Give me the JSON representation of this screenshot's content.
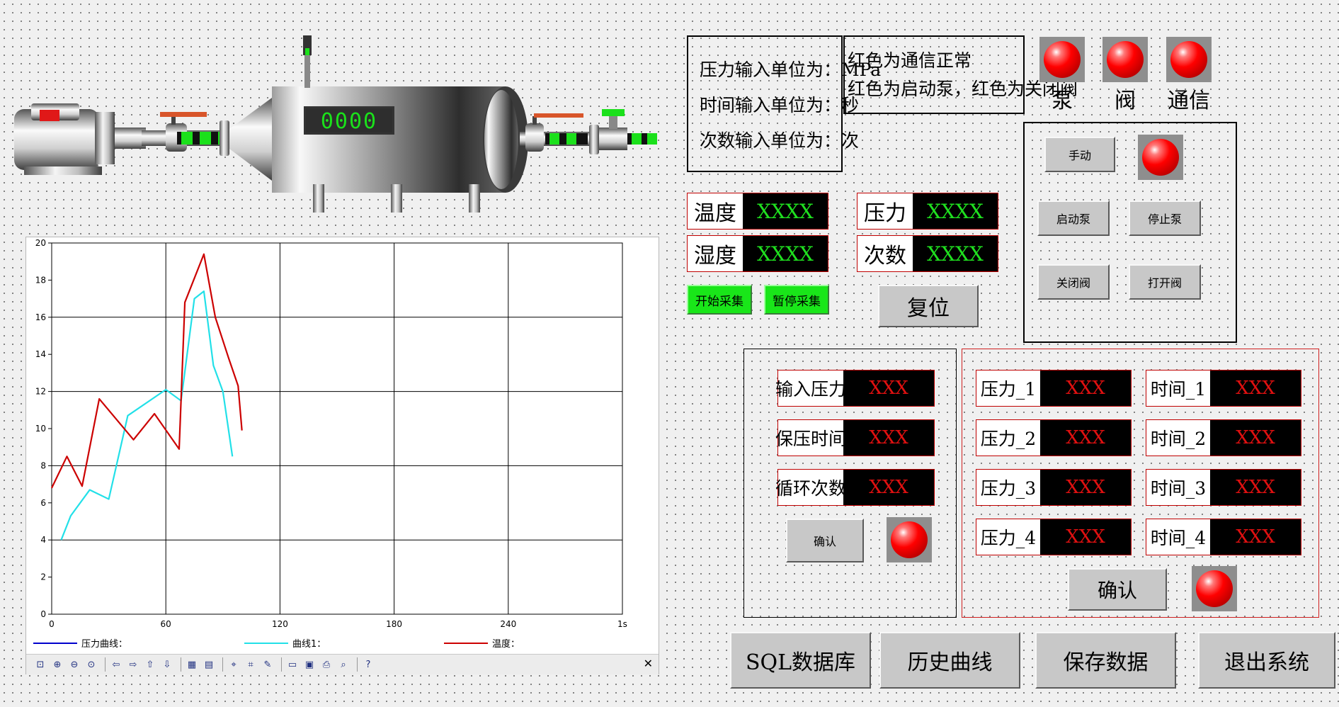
{
  "notes": {
    "units": [
      "压力输入单位为：MPa",
      "时间输入单位为：秒",
      "次数输入单位为：次"
    ],
    "legend_text": [
      "红色为通信正常",
      "红色为启动泵，红色为关闭阀"
    ]
  },
  "indicators": {
    "pump": "泵",
    "valve": "阀",
    "comm": "通信"
  },
  "tank_display": "0000",
  "sensors": {
    "temperature": {
      "label": "温度",
      "value": "XXXX"
    },
    "humidity": {
      "label": "湿度",
      "value": "XXXX"
    },
    "pressure": {
      "label": "压力",
      "value": "XXXX"
    },
    "count": {
      "label": "次数",
      "value": "XXXX"
    }
  },
  "buttons": {
    "start_collect": "开始采集",
    "pause_collect": "暂停采集",
    "reset": "复位",
    "manual": "手动",
    "start_pump": "启动泵",
    "stop_pump": "停止泵",
    "close_valve": "关闭阀",
    "open_valve": "打开阀",
    "confirm_small": "确认",
    "confirm_big": "确认",
    "sql_db": "SQL数据库",
    "history": "历史曲线",
    "save": "保存数据",
    "exit": "退出系统"
  },
  "input_params": [
    {
      "label": "输入压力",
      "value": "XXX"
    },
    {
      "label": "保压时间",
      "value": "XXX"
    },
    {
      "label": "循环次数",
      "value": "XXX"
    }
  ],
  "pressure_times": [
    {
      "p_label": "压力_1",
      "p_value": "XXX",
      "t_label": "时间_1",
      "t_value": "XXX"
    },
    {
      "p_label": "压力_2",
      "p_value": "XXX",
      "t_label": "时间_2",
      "t_value": "XXX"
    },
    {
      "p_label": "压力_3",
      "p_value": "XXX",
      "t_label": "时间_3",
      "t_value": "XXX"
    },
    {
      "p_label": "压力_4",
      "p_value": "XXX",
      "t_label": "时间_4",
      "t_value": "XXX"
    }
  ],
  "colors": {
    "led_red": "#ff0000",
    "value_green": "#1fe01f",
    "value_red": "#e01010",
    "button_green": "#19e619",
    "series_pressure": "#0000cc",
    "series_curve1": "#22e0e8",
    "series_temp": "#cc0000"
  },
  "chart_data": {
    "type": "line",
    "xlim": [
      0,
      300
    ],
    "ylim": [
      0,
      20
    ],
    "x_ticks": [
      0,
      60,
      120,
      180,
      240
    ],
    "x_end_label": "1s",
    "y_ticks": [
      0,
      2,
      4,
      6,
      8,
      10,
      12,
      14,
      16,
      18,
      20
    ],
    "grid": true,
    "legend_position": "bottom",
    "series": [
      {
        "name": "压力曲线：",
        "color": "#0000cc",
        "x": [],
        "y": []
      },
      {
        "name": "曲线1：",
        "color": "#22e0e8",
        "x": [
          5,
          10,
          20,
          30,
          40,
          60,
          68,
          75,
          80,
          85,
          90,
          95
        ],
        "y": [
          4.0,
          5.3,
          6.7,
          6.2,
          10.7,
          12.1,
          11.5,
          17.0,
          17.4,
          13.4,
          12.0,
          8.5
        ]
      },
      {
        "name": "温度：",
        "color": "#cc0000",
        "x": [
          0,
          8,
          16,
          25,
          43,
          54,
          67,
          70,
          80,
          86,
          93,
          98,
          100
        ],
        "y": [
          6.8,
          8.5,
          6.9,
          11.6,
          9.4,
          10.8,
          8.9,
          16.8,
          19.4,
          16.0,
          13.8,
          12.3,
          9.9
        ]
      }
    ]
  }
}
